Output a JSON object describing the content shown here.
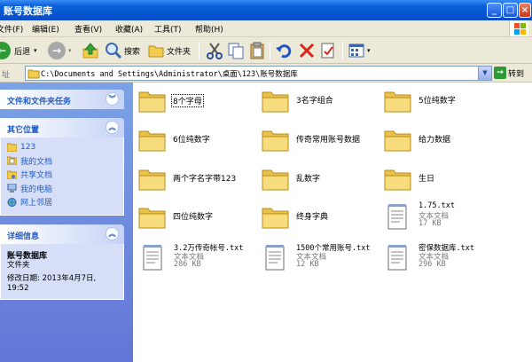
{
  "window": {
    "title": "账号数据库",
    "controls": [
      "_",
      "□",
      "×"
    ]
  },
  "menu": [
    "文件(F)",
    "编辑(E)",
    "查看(V)",
    "收藏(A)",
    "工具(T)",
    "帮助(H)"
  ],
  "toolbar": {
    "back_label": "后退",
    "search_label": "搜索",
    "folders_label": "文件夹"
  },
  "address": {
    "label": "址",
    "path": "C:\\Documents and Settings\\Administrator\\桌面\\123\\账号数据库",
    "go_label": "转到"
  },
  "left": {
    "tasks_title": "文件和文件夹任务",
    "places_title": "其它位置",
    "places": [
      "123",
      "我的文档",
      "共享文档",
      "我的电脑",
      "网上邻居"
    ],
    "details_title": "详细信息",
    "details_name": "账号数据库",
    "details_type": "文件夹",
    "details_modified_line1": "修改日期: 2013年4月7日,",
    "details_modified_line2": "19:52"
  },
  "folders": [
    "8个字母",
    "3名字组合",
    "5位纯数字",
    "6位纯数字",
    "传奇常用账号数据",
    "给力数据",
    "两个字名字带123",
    "乱数字",
    "生日",
    "四位纯数字",
    "终身字典"
  ],
  "text_files": [
    {
      "name": "1.75.txt",
      "type": "文本文档",
      "size": "17 KB"
    },
    {
      "name": "3.2万传奇帐号.txt",
      "type": "文本文档",
      "size": "286 KB"
    },
    {
      "name": "1500个常用账号.txt",
      "type": "文本文档",
      "size": "12 KB"
    },
    {
      "name": "密保数据库.txt",
      "type": "文本文档",
      "size": "296 KB"
    }
  ],
  "colors": {
    "titlebar": "#0a5fd8",
    "sidebar_link": "#215dc6",
    "folder": "#f5d66b"
  }
}
